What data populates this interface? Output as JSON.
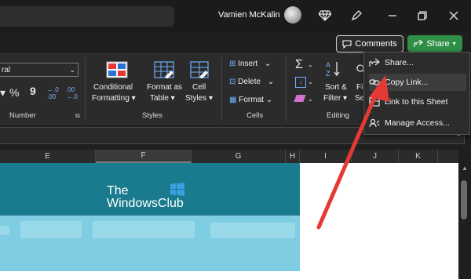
{
  "titlebar": {
    "user_name": "Vamien McKalin"
  },
  "actions": {
    "comments_label": "Comments",
    "share_label": "Share"
  },
  "ribbon": {
    "number_format_value": "ral",
    "number_group": {
      "percent": "%",
      "comma": "9",
      "label": "Number"
    },
    "styles_group": {
      "conditional": "Conditional",
      "formatting": "Formatting",
      "format_as": "Format as",
      "table": "Table",
      "cell": "Cell",
      "cell_styles": "Styles",
      "label": "Styles"
    },
    "cells_group": {
      "insert": "Insert",
      "delete": "Delete",
      "format": "Format",
      "label": "Cells"
    },
    "editing_group": {
      "sort": "Sort &",
      "filter": "Filter",
      "find": "Fi",
      "select": "Se",
      "label": "Editing"
    }
  },
  "columns": [
    "E",
    "F",
    "G",
    "H",
    "I",
    "J",
    "K"
  ],
  "logo": {
    "line1": "The",
    "line2": "WindowsClub"
  },
  "share_menu": {
    "items": [
      {
        "label": "Share...",
        "icon": "share-icon"
      },
      {
        "label": "Copy Link...",
        "icon": "link-icon"
      },
      {
        "label": "Link to this Sheet",
        "icon": "sheet-link-icon"
      },
      {
        "label": "Manage Access...",
        "icon": "manage-access-icon"
      }
    ]
  },
  "colors": {
    "share_green": "#2f8f46",
    "banner_dark": "#1a7b8f",
    "banner_light": "#7fcde2",
    "arrow": "#e53935"
  }
}
